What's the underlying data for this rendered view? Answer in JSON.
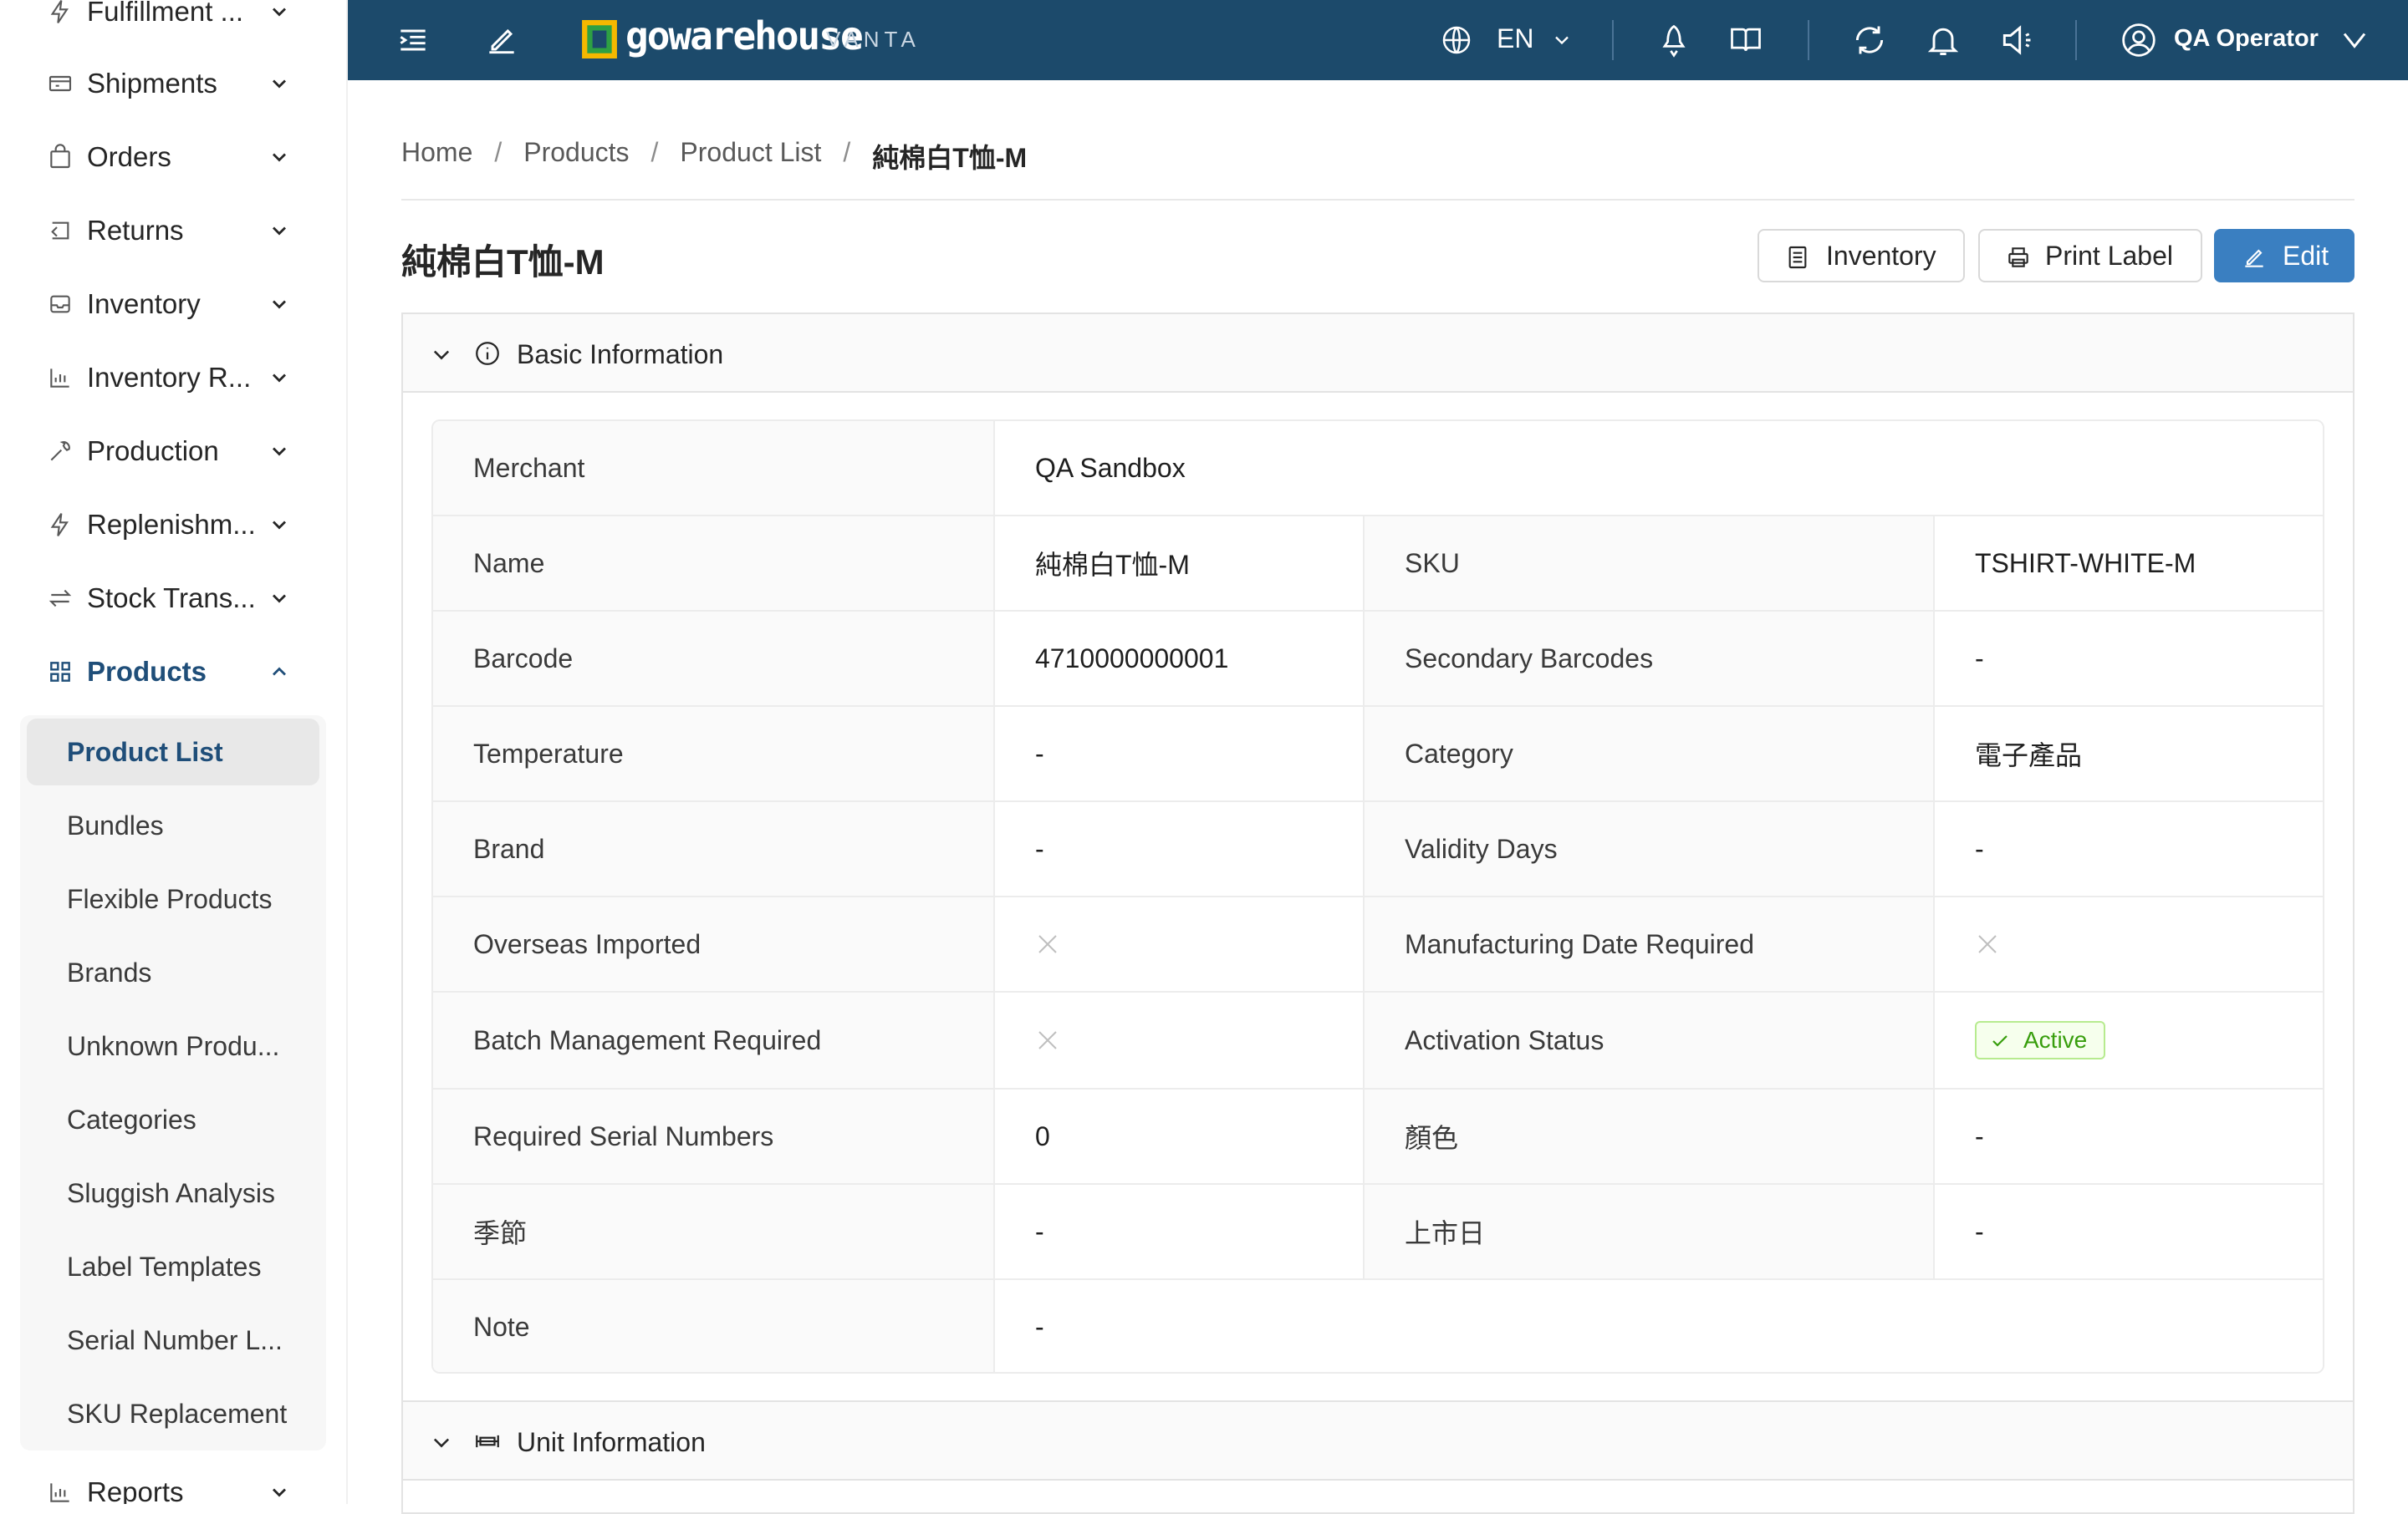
{
  "sidebar": {
    "items": [
      {
        "label": "Fulfillment ...",
        "icon": "lightning-icon"
      },
      {
        "label": "Shipments",
        "icon": "truck-icon"
      },
      {
        "label": "Orders",
        "icon": "shopping-bag-icon"
      },
      {
        "label": "Returns",
        "icon": "return-icon"
      },
      {
        "label": "Inventory",
        "icon": "inbox-icon"
      },
      {
        "label": "Inventory R...",
        "icon": "bar-chart-icon"
      },
      {
        "label": "Production",
        "icon": "tool-icon"
      },
      {
        "label": "Replenishm...",
        "icon": "lightning-icon"
      },
      {
        "label": "Stock Trans...",
        "icon": "swap-icon"
      },
      {
        "label": "Products",
        "icon": "grid-icon"
      },
      {
        "label": "Reports",
        "icon": "bar-chart-icon"
      }
    ],
    "submenu": [
      "Product List",
      "Bundles",
      "Flexible Products",
      "Brands",
      "Unknown Produ...",
      "Categories",
      "Sluggish Analysis",
      "Label Templates",
      "Serial Number L...",
      "SKU Replacement"
    ]
  },
  "header": {
    "logo_text": "gowarehouse",
    "logo_sub": "VANTA",
    "language": "EN",
    "user_name": "QA Operator",
    "colors": {
      "bar": "#1c4a6b",
      "accent": "#3a7fc1"
    }
  },
  "breadcrumb": [
    "Home",
    "Products",
    "Product List",
    "純棉白T恤-M"
  ],
  "page": {
    "title": "純棉白T恤-M",
    "buttons": {
      "inventory": "Inventory",
      "print_label": "Print Label",
      "edit": "Edit"
    }
  },
  "panels": {
    "basic": "Basic Information",
    "unit": "Unit Information"
  },
  "info": {
    "merchant_label": "Merchant",
    "merchant": "QA Sandbox",
    "name_label": "Name",
    "name": "純棉白T恤-M",
    "sku_label": "SKU",
    "sku": "TSHIRT-WHITE-M",
    "barcode_label": "Barcode",
    "barcode": "4710000000001",
    "secondary_barcodes_label": "Secondary Barcodes",
    "secondary_barcodes": "-",
    "temperature_label": "Temperature",
    "temperature": "-",
    "category_label": "Category",
    "category": "電子產品",
    "brand_label": "Brand",
    "brand": "-",
    "validity_days_label": "Validity Days",
    "validity_days": "-",
    "overseas_imported_label": "Overseas Imported",
    "manufacturing_date_required_label": "Manufacturing Date Required",
    "batch_management_required_label": "Batch Management Required",
    "activation_status_label": "Activation Status",
    "activation_status": "Active",
    "required_serial_numbers_label": "Required Serial Numbers",
    "required_serial_numbers": "0",
    "color_label": "顏色",
    "color": "-",
    "season_label": "季節",
    "season": "-",
    "launch_date_label": "上市日",
    "launch_date": "-",
    "note_label": "Note",
    "note": "-"
  }
}
